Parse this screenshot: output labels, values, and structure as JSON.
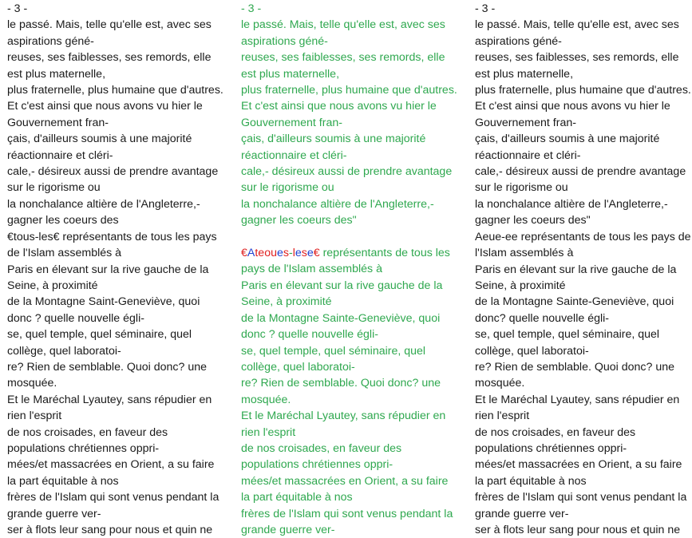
{
  "colors": {
    "text": "#1a1a1a",
    "diff_green": "#2fa84f",
    "diff_red": "#e02020",
    "diff_blue": "#2040d0"
  },
  "left": {
    "page_number": "- 3 -",
    "lines": [
      "le passé. Mais, telle qu'elle est, avec ses aspirations géné-",
      "reuses, ses faiblesses, ses remords, elle est plus maternelle,",
      "plus fraternelle, plus humaine que d'autres.",
      "Et c'est ainsi que nous avons vu hier le Gouvernement fran-",
      "çais, d'ailleurs soumis à une majorité réactionnaire et cléri-",
      "cale,- désireux aussi de prendre avantage sur le rigorisme ou",
      "la nonchalance altière de l'Angleterre,- gagner les coeurs des",
      "€tous-les€ représentants de tous les pays de l'Islam assemblés à",
      "Paris en élevant sur la rive gauche de la Seine, à proximité",
      "de la Montagne Saint-Geneviève, quoi donc ? quelle nouvelle égli-",
      "se, quel temple, quel séminaire, quel collège, quel laboratoi-",
      "re? Rien de semblable. Quoi donc? une mosquée.",
      "Et le Maréchal Lyautey, sans répudier en rien l'esprit",
      "de nos croisades, en faveur des populations chrétiennes oppri-",
      "mées/et massacrées en Orient, a su faire la part équitable à nos",
      "frères de l'Islam qui sont venus pendant la grande guerre ver-",
      "ser à flots leur sang pour nous et quin ne"
    ]
  },
  "middle": {
    "page_number": "- 3 -",
    "lines_before": [
      "le passé. Mais, telle qu'elle est, avec ses aspirations géné-",
      "reuses, ses faiblesses, ses remords, elle est plus maternelle,",
      "plus fraternelle, plus humaine que d'autres.",
      "Et c'est ainsi que nous avons vu hier le Gouvernement fran-",
      "çais, d'ailleurs soumis à une majorité réactionnaire et cléri-",
      "cale,- désireux aussi de prendre avantage sur le rigorisme ou",
      "la nonchalance altière de l'Angleterre,- gagner les coeurs des\""
    ],
    "diff_line": {
      "euro_open": "€",
      "a": "A",
      "teou": "teou",
      "e1": "e",
      "s1": "s",
      "dash": "-",
      "l": "l",
      "e2": "e",
      "s2": "s",
      "e3": "e",
      "euro_close": "€",
      "rest": " représentants de tous les pays de l'Islam assemblés à"
    },
    "lines_after": [
      "Paris en élevant sur la rive gauche de la Seine, à proximité",
      "de la Montagne Sainte-Geneviève, quoi donc ? quelle nouvelle égli-",
      "se, quel temple, quel séminaire, quel collège, quel laboratoi-",
      "re? Rien de semblable. Quoi donc? une mosquée.",
      "Et le Maréchal Lyautey, sans répudier en rien l'esprit",
      "de nos croisades, en faveur des populations chrétiennes oppri-",
      "mées/et massacrées en Orient, a su faire la part équitable à nos",
      "frères de l'Islam qui sont venus pendant la grande guerre ver-"
    ]
  },
  "right": {
    "page_number": "- 3 -",
    "lines": [
      "le passé. Mais, telle qu'elle est, avec ses aspirations géné-",
      "reuses, ses faiblesses, ses remords, elle est plus maternelle,",
      "plus fraternelle, plus humaine que d'autres.",
      "Et c'est ainsi que nous avons vu hier le Gouvernement fran-",
      "çais, d'ailleurs soumis à une majorité réactionnaire et cléri-",
      "cale,- désireux aussi de prendre avantage sur le rigorisme ou",
      "la nonchalance altière de l'Angleterre,- gagner les coeurs des\"",
      "Aeue-ee représentants de tous les pays de l'Islam assemblés à",
      "Paris en élevant sur la rive gauche de la Seine, à proximité",
      "de la Montagne Sainte-Geneviève, quoi donc? quelle nouvelle égli-",
      "se, quel temple, quel séminaire, quel collège, quel laboratoi-",
      "re? Rien de semblable. Quoi donc? une mosquée.",
      "Et le Maréchal Lyautey, sans répudier en rien l'esprit",
      "de nos croisades, en faveur des populations chrétiennes oppri-",
      "mées/et massacrées en Orient, a su faire la part équitable à nos",
      "frères de l'Islam qui sont venus pendant la grande guerre ver-",
      "ser à flots leur sang pour nous et quin ne"
    ]
  }
}
